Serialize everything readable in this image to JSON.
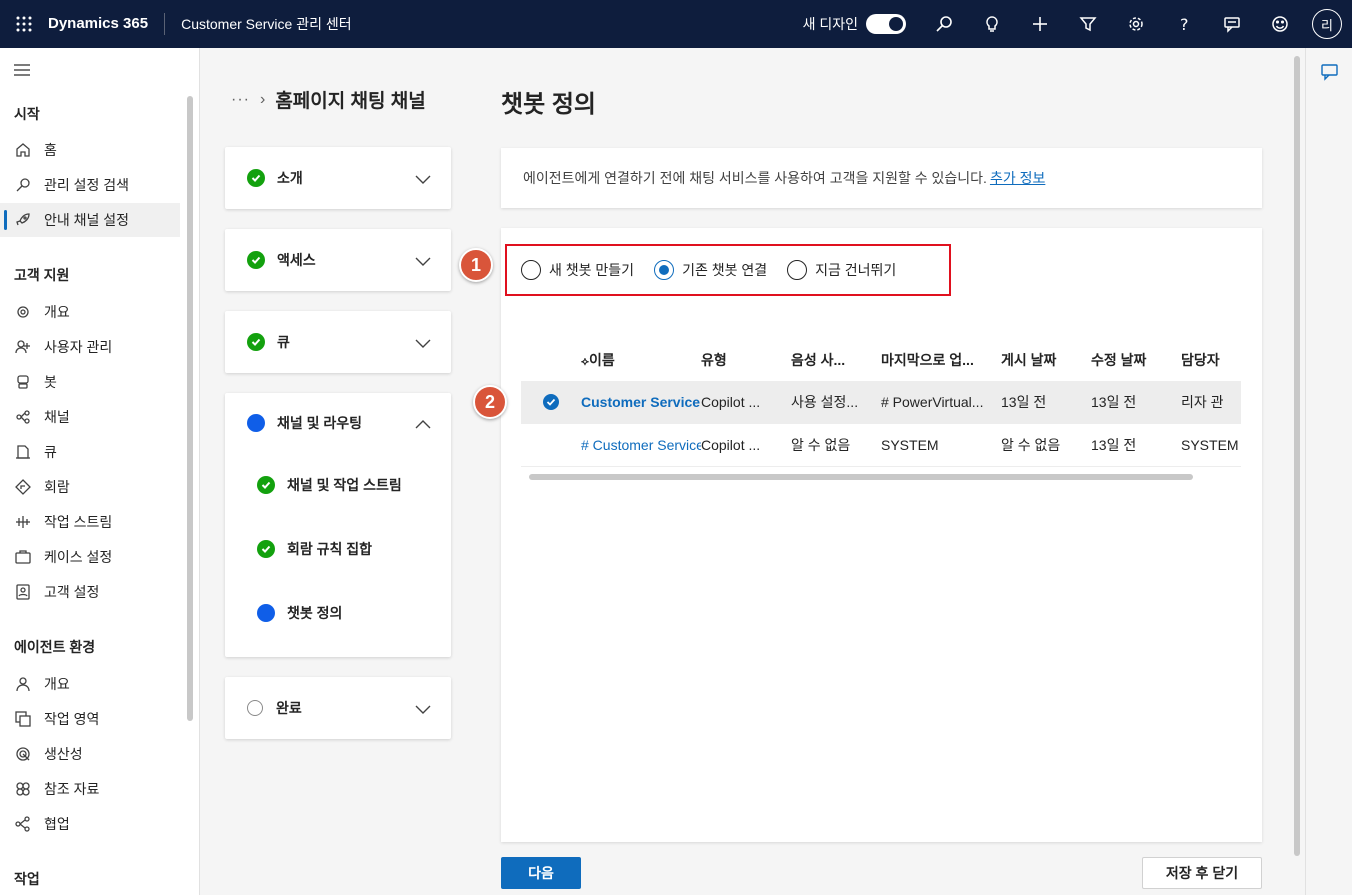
{
  "topbar": {
    "brand": "Dynamics 365",
    "app": "Customer Service 관리 센터",
    "new_design": "새 디자인",
    "avatar": "리"
  },
  "nav": {
    "sections": [
      "시작",
      "고객 지원",
      "에이전트 환경",
      "작업"
    ],
    "start_items": [
      {
        "label": "홈",
        "icon": "home-icon"
      },
      {
        "label": "관리 설정 검색",
        "icon": "search-icon"
      },
      {
        "label": "안내 채널 설정",
        "icon": "rocket-icon"
      }
    ],
    "support_items": [
      {
        "label": "개요",
        "icon": "overview-icon"
      },
      {
        "label": "사용자 관리",
        "icon": "users-icon"
      },
      {
        "label": "봇",
        "icon": "bot-icon"
      },
      {
        "label": "채널",
        "icon": "channel-icon"
      },
      {
        "label": "큐",
        "icon": "queue-icon"
      },
      {
        "label": "회람",
        "icon": "routing-icon"
      },
      {
        "label": "작업 스트림",
        "icon": "workstream-icon"
      },
      {
        "label": "케이스 설정",
        "icon": "case-icon"
      },
      {
        "label": "고객 설정",
        "icon": "customer-icon"
      }
    ],
    "agent_items": [
      {
        "label": "개요",
        "icon": "person-icon"
      },
      {
        "label": "작업 영역",
        "icon": "workspace-icon"
      },
      {
        "label": "생산성",
        "icon": "productivity-icon"
      },
      {
        "label": "참조 자료",
        "icon": "knowledge-icon"
      },
      {
        "label": "협업",
        "icon": "collab-icon"
      }
    ]
  },
  "steps": {
    "breadcrumb_dots": "···",
    "breadcrumb_title": "홈페이지 채팅 채널",
    "cards": [
      {
        "label": "소개",
        "status": "done"
      },
      {
        "label": "액세스",
        "status": "done"
      },
      {
        "label": "큐",
        "status": "done"
      },
      {
        "label": "채널 및 라우팅",
        "status": "current"
      },
      {
        "label": "완료",
        "status": "pending"
      }
    ],
    "substeps": [
      {
        "label": "채널 및 작업 스트림",
        "status": "done"
      },
      {
        "label": "회람 규칙 집합",
        "status": "done"
      },
      {
        "label": "챗봇 정의",
        "status": "current"
      }
    ]
  },
  "main": {
    "title": "챗봇 정의",
    "info_text": "에이전트에게 연결하기 전에 채팅 서비스를 사용하여 고객을 지원할 수 있습니다.",
    "info_link": "추가 정보",
    "radios": [
      {
        "label": "새 챗봇 만들기",
        "selected": false
      },
      {
        "label": "기존 챗봇 연결",
        "selected": true
      },
      {
        "label": "지금 건너뛰기",
        "selected": false
      }
    ],
    "badge1": "1",
    "badge2": "2",
    "columns": [
      "이름",
      "유형",
      "음성 사...",
      "마지막으로 업...",
      "게시 날짜",
      "수정 날짜",
      "담당자"
    ],
    "rows": [
      [
        "Customer Service",
        "Copilot ...",
        "사용 설정...",
        "# PowerVirtual...",
        "13일 전",
        "13일 전",
        "리자 관"
      ],
      [
        "# Customer Service",
        "Copilot ...",
        "알 수 없음",
        "SYSTEM",
        "알 수 없음",
        "13일 전",
        "SYSTEM"
      ]
    ],
    "next_button": "다음",
    "save_close_button": "저장 후 닫기"
  },
  "colors": {
    "topbar": "#0e1d3d",
    "accent": "#0f6cbd",
    "success": "#13a10e",
    "highlight_box": "#e0101e",
    "badge": "#d9553a"
  }
}
